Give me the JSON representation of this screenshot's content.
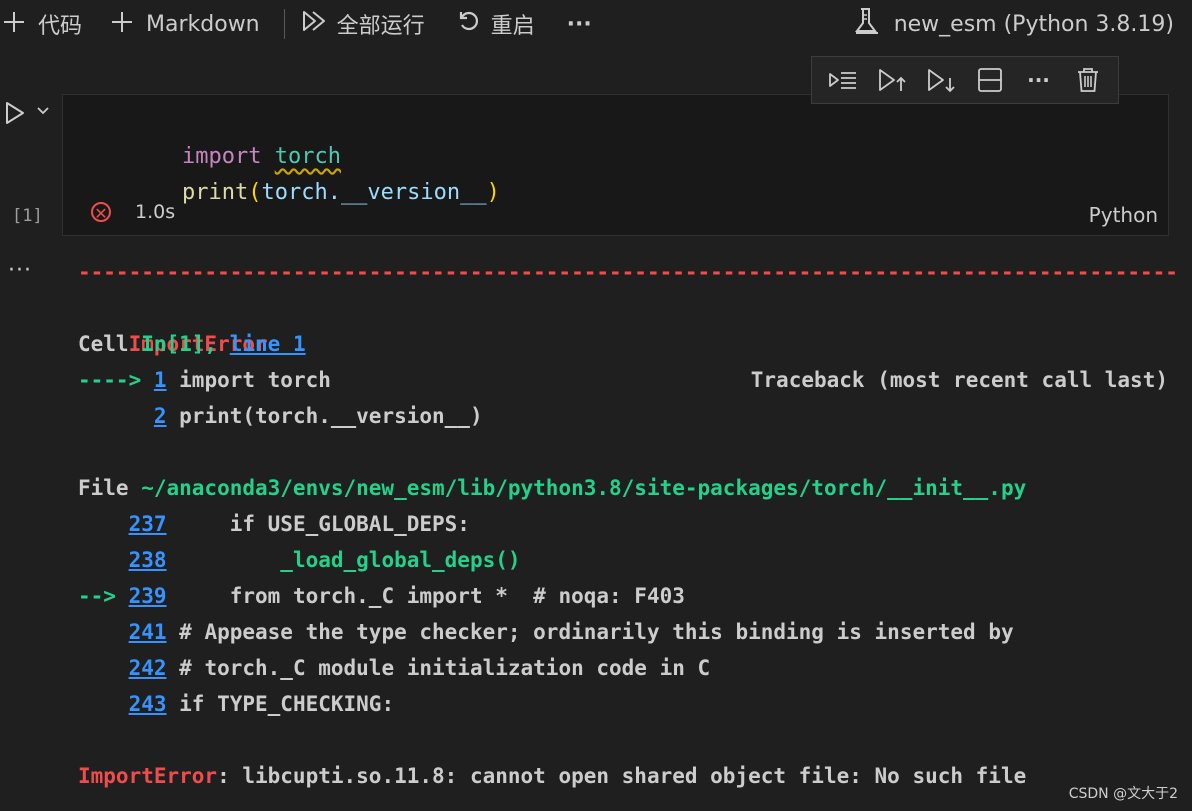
{
  "toolbar": {
    "add_code": "代码",
    "add_markdown": "Markdown",
    "run_all": "全部运行",
    "restart": "重启",
    "more": "···",
    "kernel": "new_esm (Python 3.8.19)"
  },
  "cell": {
    "code": {
      "line1_kw": "import",
      "line1_mod": "torch",
      "line2_fn": "print",
      "line2_open": "(",
      "line2_var": "torch.__version__",
      "line2_close": ")"
    },
    "exec_count": "[1]",
    "duration": "1.0s",
    "language": "Python"
  },
  "output": {
    "dashes": "--------------------------------------------------------------------------------------------------------",
    "error_type": "ImportError",
    "traceback_header": "Traceback (most recent call last)",
    "cell_ref": {
      "prefix": "Cell ",
      "in": "In[1], ",
      "link": "line 1"
    },
    "arrow1": "----> ",
    "ln1": "1",
    "code1": " import torch",
    "indent2": "      ",
    "ln2": "2",
    "code2": " print(torch.__version__)",
    "file_label": "File ",
    "file_path": "~/anaconda3/envs/new_esm/lib/python3.8/site-packages/torch/__init__.py",
    "frames": [
      {
        "arrow": "    ",
        "ln": "237",
        "code": "     if USE_GLOBAL_DEPS:"
      },
      {
        "arrow": "    ",
        "ln": "238",
        "code": "         _load_global_deps()"
      },
      {
        "arrow": "--> ",
        "ln": "239",
        "code": "     from torch._C import *  # noqa: F403"
      },
      {
        "arrow": "    ",
        "ln": "241",
        "code": " # Appease the type checker; ordinarily this binding is inserted by"
      },
      {
        "arrow": "    ",
        "ln": "242",
        "code": " # torch._C module initialization code in C"
      },
      {
        "arrow": "    ",
        "ln": "243",
        "code": " if TYPE_CHECKING:"
      }
    ],
    "final_error_type": "ImportError",
    "final_error_msg": ": libcupti.so.11.8: cannot open shared object file: No such file"
  },
  "watermark": "CSDN @文大于2",
  "colors": {
    "error": "#f14c4c",
    "green": "#23d18b",
    "link": "#3794ff",
    "background": "#1f1f1f"
  }
}
